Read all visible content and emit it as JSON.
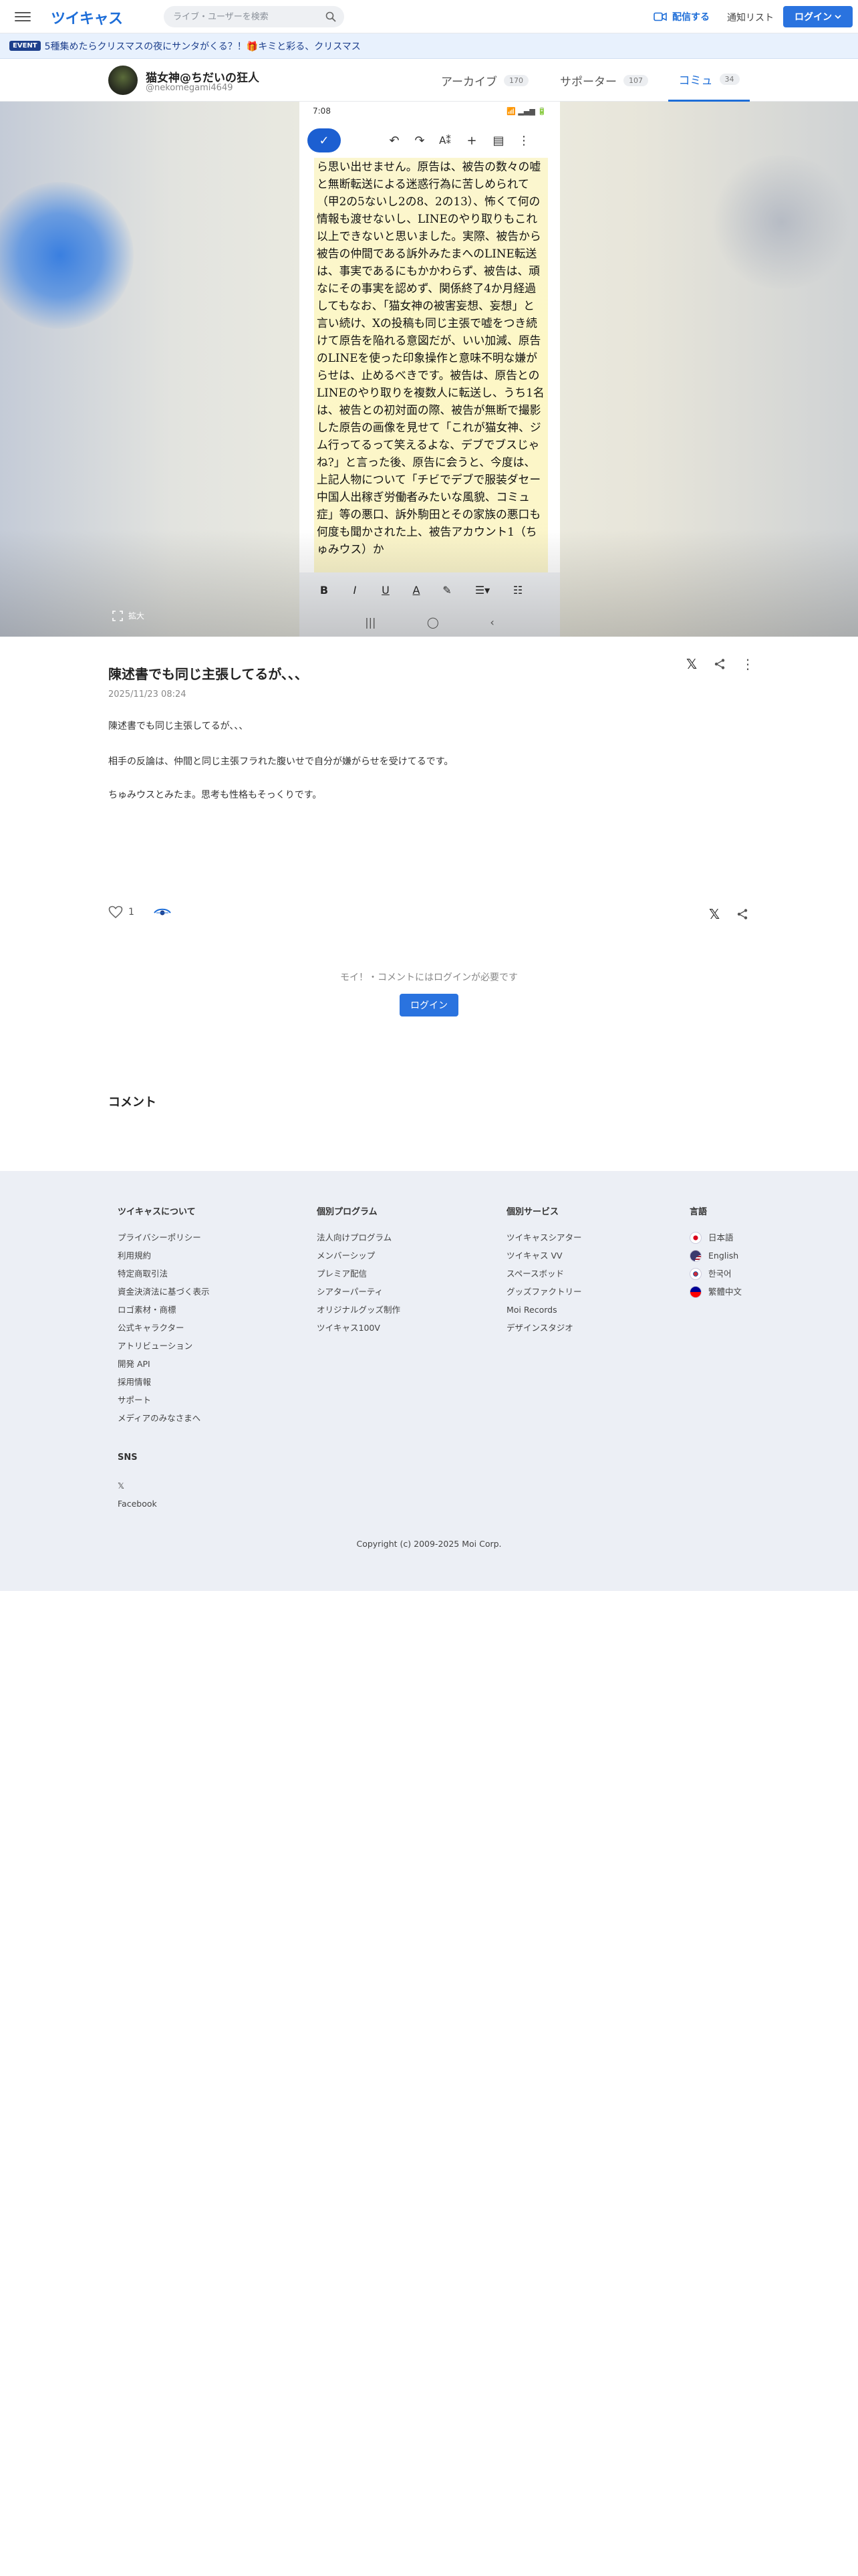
{
  "header": {
    "logo": "ツイキャス",
    "search_placeholder": "ライブ・ユーザーを検索",
    "broadcast_label": "配信する",
    "notify_label": "通知リスト",
    "login_label": "ログイン"
  },
  "event": {
    "badge": "EVENT",
    "text": "5種集めたらクリスマスの夜にサンタがくる？！🎁キミと彩る、クリスマス"
  },
  "profile": {
    "name": "猫女神@ちだいの狂人",
    "id": "@nekomegami4649"
  },
  "tabs": [
    {
      "label": "アーカイブ",
      "count": "170"
    },
    {
      "label": "サポーター",
      "count": "107"
    },
    {
      "label": "コミュ",
      "count": "34"
    }
  ],
  "photo": {
    "status_time": "7:08",
    "status_icons": "📶 ▂▄▆ 🔋",
    "zoom_label": "拡大",
    "doc_text": "ら思い出せません。原告は、被告の数々の嘘と無断転送による迷惑行為に苦しめられて（甲2の5ないし2の8、2の13）、怖くて何の情報も渡せないし、LINEのやり取りもこれ以上できないと思いました。実際、被告から被告の仲間である訴外みたまへのLINE転送は、事実であるにもかかわらず、被告は、頑なにその事実を認めず、関係終了4か月経過してもなお、「猫女神の被害妄想、妄想」と言い続け、Xの投稿も同じ主張で嘘をつき続けて原告を陥れる意図だが、いい加減、原告のLINEを使った印象操作と意味不明な嫌がらせは、止めるべきです。被告は、原告とのLINEのやり取りを複数人に転送し、うち1名は、被告との初対面の際、被告が無断で撮影した原告の画像を見せて「これが猫女神、ジム行ってるって笑えるよな、デブでブスじゃね?」と言った後、原告に会うと、今度は、上記人物について「チビでデブで服装ダセー中国人出稼ぎ労働者みたいな風貌、コミュ症」等の悪口、訴外駒田とその家族の悪口も何度も聞かされた上、被告アカウント1（ちゅみウス）か"
  },
  "post": {
    "title": "陳述書でも同じ主張してるが､､､",
    "date": "2025/11/23 08:24",
    "body": [
      "陳述書でも同じ主張してるが､､､",
      "相手の反論は、仲間と同じ主張フラれた腹いせで自分が嫌がらせを受けてるです。",
      "ちゅみウスとみたま。思考も性格もそっくりです。"
    ],
    "like_count": "1",
    "login_prompt": "モイ！・コメントにはログインが必要です",
    "login_button": "ログイン",
    "comments_heading": "コメント"
  },
  "footer": {
    "columns": [
      {
        "heading": "ツイキャスについて",
        "items": [
          "プライバシーポリシー",
          "利用規約",
          "特定商取引法",
          "資金決済法に基づく表示",
          "ロゴ素材・商標",
          "公式キャラクター",
          "アトリビューション",
          "開発 API",
          "採用情報",
          "サポート",
          "メディアのみなさまへ"
        ]
      },
      {
        "heading": "個別プログラム",
        "items": [
          "法人向けプログラム",
          "メンバーシップ",
          "プレミア配信",
          "シアターパーティ",
          "オリジナルグッズ制作",
          "ツイキャス100V"
        ]
      },
      {
        "heading": "個別サービス",
        "items": [
          "ツイキャスシアター",
          "ツイキャス VV",
          "スペースボッド",
          "グッズファクトリー",
          "Moi Records",
          "デザインスタジオ"
        ]
      },
      {
        "heading": "言語",
        "items": [
          "日本語",
          "English",
          "한국어",
          "繁體中文"
        ]
      }
    ],
    "sns_heading": "SNS",
    "sns_items": [
      "𝕏",
      "Facebook"
    ],
    "copyright": "Copyright (c) 2009-2025 Moi Corp."
  },
  "colors": {
    "accent": "#2a73df",
    "brand": "#1e6ed8",
    "footer_bg": "#eceff5",
    "highlight": "#fbf6cf"
  }
}
